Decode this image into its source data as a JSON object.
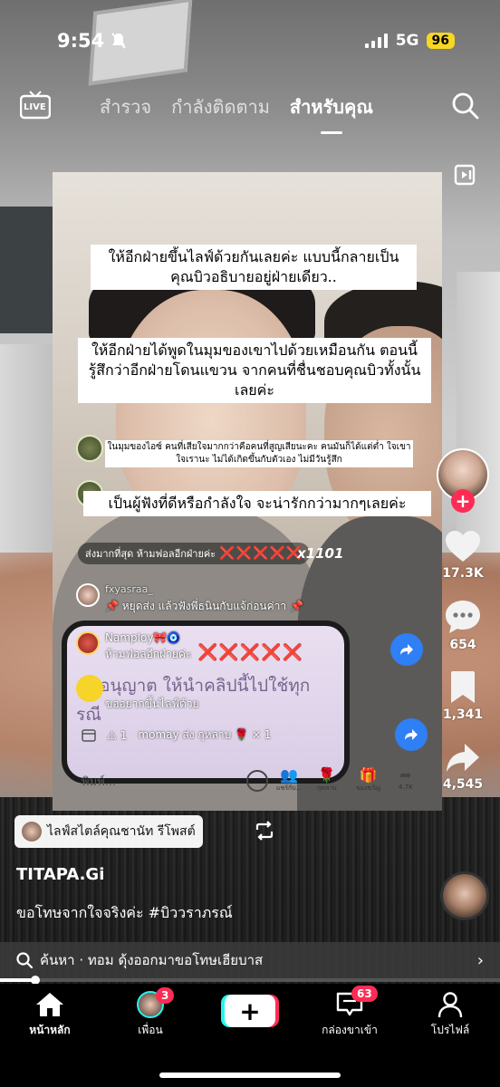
{
  "status_bar": {
    "time": "9:54",
    "network": "5G",
    "battery": "96"
  },
  "top_nav": {
    "live_label": "LIVE",
    "tabs": [
      {
        "label": "สำรวจ",
        "active": false
      },
      {
        "label": "กำลังติดตาม",
        "active": false
      },
      {
        "label": "สำหรับคุณ",
        "active": true
      }
    ]
  },
  "video": {
    "caption_1": "ให้อีกฝ่ายขึ้นไลฟ์ด้วยกันเลยค่ะ แบบนี้กลายเป็นคุณบิวอธิบายอยู่ฝ่ายเดียว..",
    "caption_2": "ให้อีกฝ่ายได้พูดในมุมของเขาไปด้วยเหมือนกัน ตอนนี้รู้สึกว่าอีกฝ่ายโดนแขวน จากคนที่ชื่นชอบคุณบิวทั้งนั้นเลยค่ะ",
    "caption_small": "ในมุมของไอซ์ คนที่เสียใจมากกว่าคือคนที่สูญเสียนะคะ คนมันก็ได้แต่ต่ำ ใจเขาใจเรานะ ไม่ได้เกิดขึ้นกับตัวเอง ไม่มีวันรู้สึก",
    "caption_3": "เป็นผู้ฟังที่ดีหรือกำลังใจ จะน่ารักกว่ามากๆเลยค่ะ",
    "gift_banner_label": "ส่งมากที่สุด ห้ามฟอลอีกฝ่ายค่ะ",
    "gift_banner_marks": "❌❌❌❌❌",
    "gift_multiplier": "x1101",
    "comment_user_1": "fxyasraa_",
    "comment_text_1": "📌 หยุดส่ง แล้วฟังพี่ธนินกับแจ้ก่อนค่าา 📌",
    "comment_user_2": "Namploy🎀🧿",
    "comment_text_2": "ห้ามฟอลอีกฝ่ายค่ะ",
    "comment_marks_2": "❌❌❌❌❌",
    "inner_watermark_1": "อนุญาต ให้นำคลิปนี้ไปใช้ทุก",
    "inner_watermark_2": "รณี",
    "inner_request": "ขออยากขึ้นไลฟ์ด้วย",
    "gift_line_count": "1",
    "gift_line_text": "momay ส่ง กุหลาบ 🌹 × 1",
    "inner_input_placeholder": "พิมพ์...",
    "inner_icons": [
      "แชร์กับ...",
      "กุหลาบ",
      "ของขวัญ",
      "4.7K"
    ]
  },
  "actions": {
    "likes": "17.3K",
    "comments": "654",
    "saves": "1,341",
    "shares": "4,545"
  },
  "info": {
    "music_label": "ไลฟ์สไตล์คุณชานัท รีโพสต์",
    "author": "TITAPA.Gi",
    "description": "ขอโทษจากใจจริงค่ะ #บิววราภรณ์",
    "search_text": "ค้นหา · ทอม ดุ้งออกมาขอโทษเฮียบาส",
    "progress": 0.07
  },
  "bottom_nav": {
    "home": "หน้าหลัก",
    "friends": "เพื่อน",
    "friends_badge": "3",
    "inbox": "กล่องขาเข้า",
    "inbox_badge": "63",
    "profile": "โปรไฟล์"
  },
  "colors": {
    "accent_red": "#fe2c55",
    "accent_cyan": "#25f4ee",
    "battery": "#f7d722",
    "share_blue": "#2f7ff5"
  }
}
